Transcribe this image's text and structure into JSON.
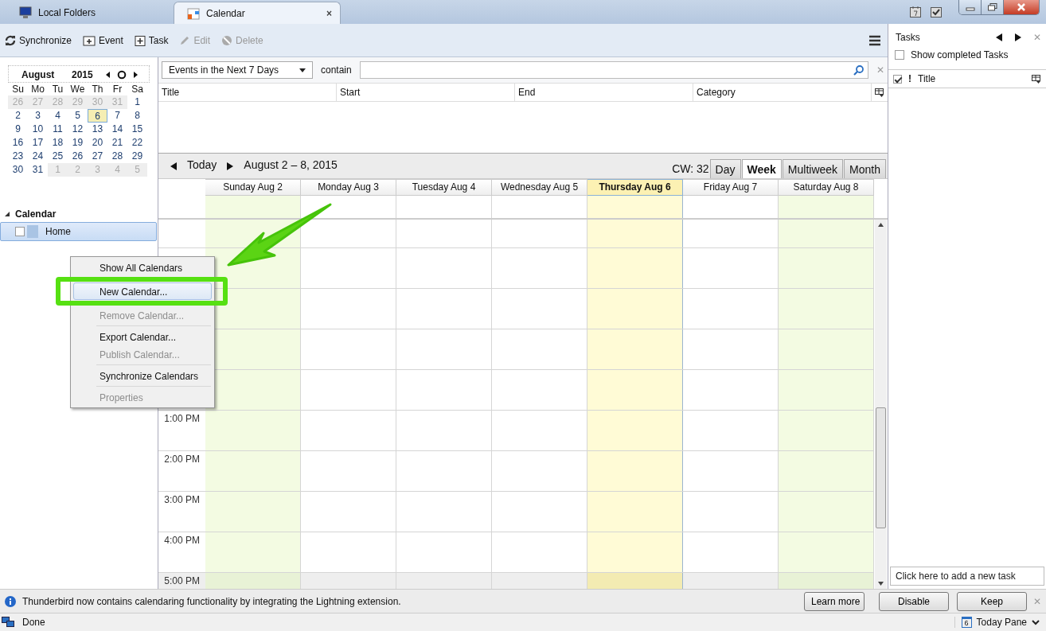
{
  "tabs": [
    {
      "label": "Local Folders",
      "selected": false
    },
    {
      "label": "Calendar",
      "selected": true,
      "close": "×"
    }
  ],
  "toolbar": [
    {
      "label": "Synchronize",
      "kind": "sync",
      "disabled": false
    },
    {
      "label": "Event",
      "kind": "event",
      "disabled": false
    },
    {
      "label": "Task",
      "kind": "task",
      "disabled": false
    },
    {
      "label": "Edit",
      "kind": "edit",
      "disabled": true
    },
    {
      "label": "Delete",
      "kind": "delete",
      "disabled": true
    }
  ],
  "minical": {
    "month": "August",
    "year": "2015",
    "weekdays": [
      "Su",
      "Mo",
      "Tu",
      "We",
      "Th",
      "Fr",
      "Sa"
    ],
    "weeks": [
      [
        {
          "d": "26",
          "other": true,
          "selected": false
        },
        {
          "d": "27",
          "other": true,
          "selected": false
        },
        {
          "d": "28",
          "other": true,
          "selected": false
        },
        {
          "d": "29",
          "other": true,
          "selected": false
        },
        {
          "d": "30",
          "other": true,
          "selected": false
        },
        {
          "d": "31",
          "other": true,
          "selected": false
        },
        {
          "d": "1",
          "other": false,
          "selected": false
        }
      ],
      [
        {
          "d": "2",
          "other": false,
          "selected": false
        },
        {
          "d": "3",
          "other": false,
          "selected": false
        },
        {
          "d": "4",
          "other": false,
          "selected": false
        },
        {
          "d": "5",
          "other": false,
          "selected": false
        },
        {
          "d": "6",
          "other": false,
          "selected": true
        },
        {
          "d": "7",
          "other": false,
          "selected": false
        },
        {
          "d": "8",
          "other": false,
          "selected": false
        }
      ],
      [
        {
          "d": "9",
          "other": false,
          "selected": false
        },
        {
          "d": "10",
          "other": false,
          "selected": false
        },
        {
          "d": "11",
          "other": false,
          "selected": false
        },
        {
          "d": "12",
          "other": false,
          "selected": false
        },
        {
          "d": "13",
          "other": false,
          "selected": false
        },
        {
          "d": "14",
          "other": false,
          "selected": false
        },
        {
          "d": "15",
          "other": false,
          "selected": false
        }
      ],
      [
        {
          "d": "16",
          "other": false,
          "selected": false
        },
        {
          "d": "17",
          "other": false,
          "selected": false
        },
        {
          "d": "18",
          "other": false,
          "selected": false
        },
        {
          "d": "19",
          "other": false,
          "selected": false
        },
        {
          "d": "20",
          "other": false,
          "selected": false
        },
        {
          "d": "21",
          "other": false,
          "selected": false
        },
        {
          "d": "22",
          "other": false,
          "selected": false
        }
      ],
      [
        {
          "d": "23",
          "other": false,
          "selected": false
        },
        {
          "d": "24",
          "other": false,
          "selected": false
        },
        {
          "d": "25",
          "other": false,
          "selected": false
        },
        {
          "d": "26",
          "other": false,
          "selected": false
        },
        {
          "d": "27",
          "other": false,
          "selected": false
        },
        {
          "d": "28",
          "other": false,
          "selected": false
        },
        {
          "d": "29",
          "other": false,
          "selected": false
        }
      ],
      [
        {
          "d": "30",
          "other": false,
          "selected": false
        },
        {
          "d": "31",
          "other": false,
          "selected": false
        },
        {
          "d": "1",
          "other": true,
          "selected": false
        },
        {
          "d": "2",
          "other": true,
          "selected": false
        },
        {
          "d": "3",
          "other": true,
          "selected": false
        },
        {
          "d": "4",
          "other": true,
          "selected": false
        },
        {
          "d": "5",
          "other": true,
          "selected": false
        }
      ]
    ]
  },
  "calendar_list": {
    "heading": "Calendar",
    "expanded": true,
    "items": [
      {
        "name": "Home",
        "checked": false,
        "selected": true,
        "color": "#a9c4e4"
      }
    ]
  },
  "context_menu": [
    {
      "label": "Show All Calendars",
      "disabled": false,
      "selected": false,
      "separator_after": false
    },
    {
      "label": "New Calendar...",
      "disabled": false,
      "selected": true,
      "separator_after": false
    },
    {
      "label": "Remove Calendar...",
      "disabled": true,
      "selected": false,
      "separator_after": true
    },
    {
      "label": "Export Calendar...",
      "disabled": false,
      "selected": false,
      "separator_after": false
    },
    {
      "label": "Publish Calendar...",
      "disabled": true,
      "selected": false,
      "separator_after": true
    },
    {
      "label": "Synchronize Calendars",
      "disabled": false,
      "selected": false,
      "separator_after": true
    },
    {
      "label": "Properties",
      "disabled": true,
      "selected": false,
      "separator_after": false
    }
  ],
  "filter": {
    "range": "Events in the Next 7 Days",
    "contain_label": "contain",
    "close": "✕"
  },
  "event_list": {
    "columns": [
      "Title",
      "Start",
      "End",
      "Category"
    ]
  },
  "week_nav": {
    "today": "Today",
    "range": "August 2 – 8, 2015",
    "cw": "CW: 32"
  },
  "views": [
    {
      "label": "Day",
      "selected": false
    },
    {
      "label": "Week",
      "selected": true
    },
    {
      "label": "Multiweek",
      "selected": false
    },
    {
      "label": "Month",
      "selected": false
    }
  ],
  "days": [
    {
      "label": "Sunday Aug 2",
      "weekend": true,
      "today": false
    },
    {
      "label": "Monday Aug 3",
      "weekend": false,
      "today": false
    },
    {
      "label": "Tuesday Aug 4",
      "weekend": false,
      "today": false
    },
    {
      "label": "Wednesday Aug 5",
      "weekend": false,
      "today": false
    },
    {
      "label": "Thursday Aug 6",
      "weekend": false,
      "today": true
    },
    {
      "label": "Friday Aug 7",
      "weekend": false,
      "today": false
    },
    {
      "label": "Saturday Aug 8",
      "weekend": true,
      "today": false
    }
  ],
  "hours": [
    "1:00 PM",
    "2:00 PM",
    "3:00 PM",
    "4:00 PM",
    "5:00 PM"
  ],
  "tasks": {
    "title": "Tasks",
    "close": "✕",
    "show_completed": {
      "label": "Show completed Tasks",
      "checked": false
    },
    "columns": {
      "done_header_checked": true,
      "priority": "!",
      "title": "Title"
    },
    "new_task_placeholder": "Click here to add a new task"
  },
  "notification": {
    "text": "Thunderbird now contains calendaring functionality by integrating the Lightning extension.",
    "buttons": [
      "Learn more",
      "Disable",
      "Keep"
    ],
    "close": "✕"
  },
  "status": {
    "text": "Done",
    "today_pane": "Today Pane",
    "today_day": "6"
  }
}
